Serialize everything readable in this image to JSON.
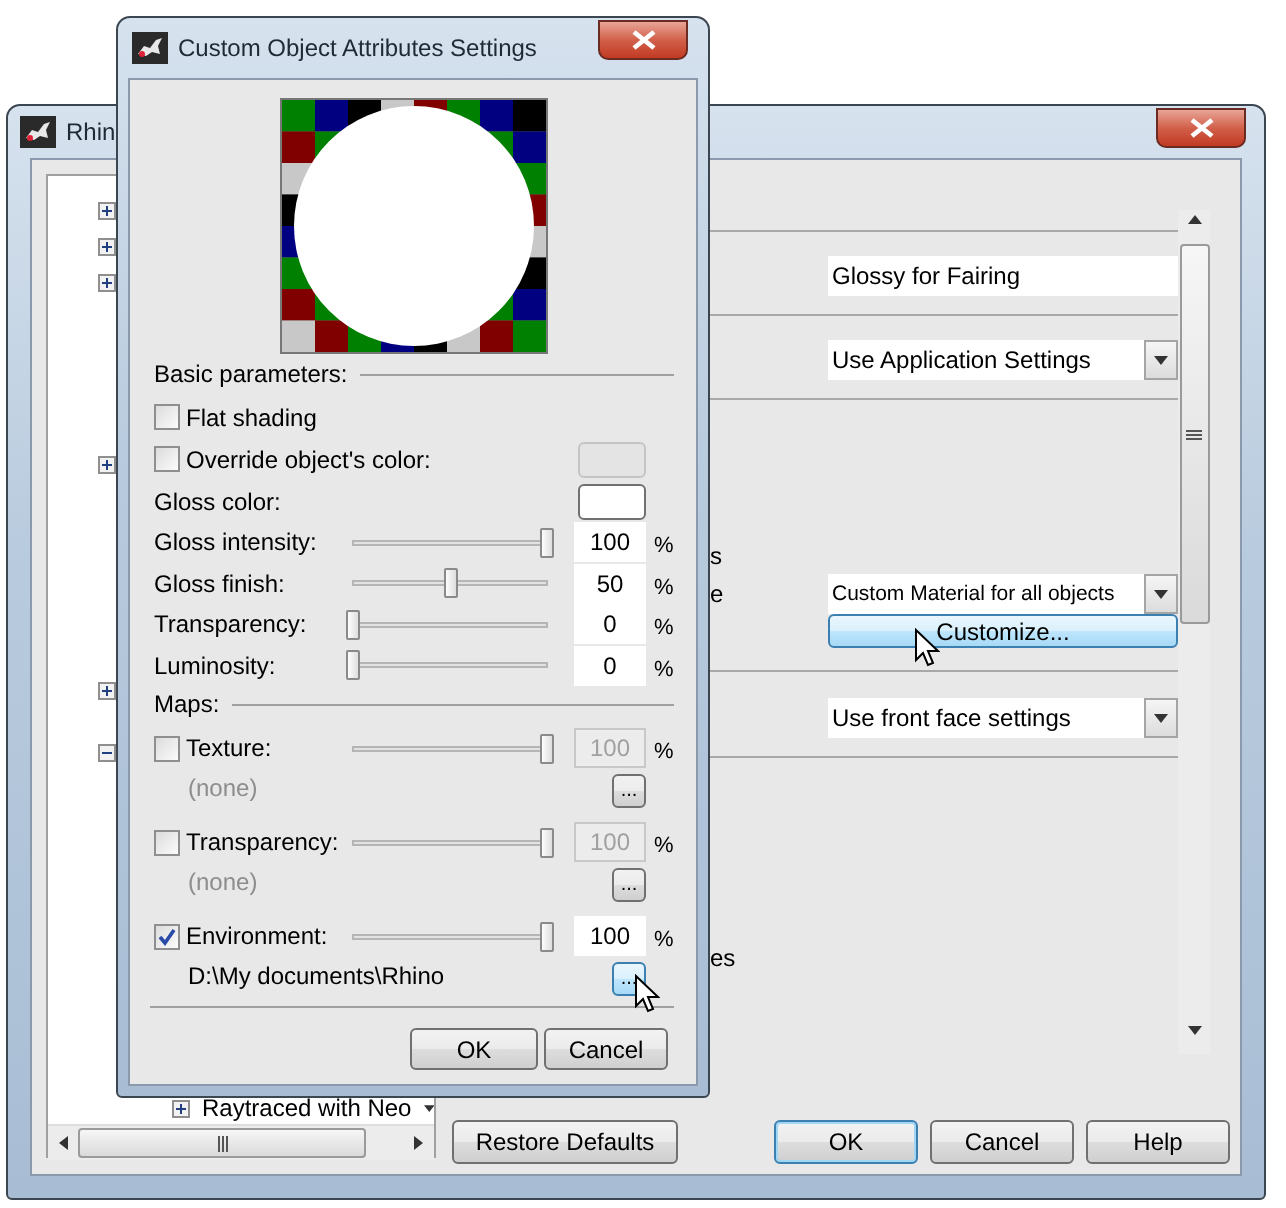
{
  "main_window": {
    "title": "Rhin",
    "tree": [
      {
        "expanded": false
      },
      {
        "expanded": false
      },
      {
        "expanded": false
      },
      {
        "expanded": false
      },
      {
        "expanded": false
      },
      {
        "expanded": true,
        "children": [
          {
            "label": "Raytraced with Neo",
            "expanded": false
          }
        ]
      }
    ],
    "sections": [
      {
        "field": {
          "kind": "text",
          "value": "Glossy for Fairing"
        }
      },
      {
        "field": {
          "kind": "dropdown",
          "value": "Use Application Settings"
        }
      },
      {
        "labels": [
          "s",
          "e"
        ],
        "field": {
          "kind": "dropdown",
          "value": "Custom Material for all objects"
        },
        "button": {
          "label": "Customize...",
          "hovered": true
        }
      },
      {
        "field": {
          "kind": "dropdown",
          "value": "Use front face settings"
        }
      },
      {
        "labels": [
          "es"
        ]
      }
    ],
    "restore_button": "Restore Defaults",
    "buttons": [
      {
        "label": "OK",
        "default": true
      },
      {
        "label": "Cancel",
        "default": false
      },
      {
        "label": "Help",
        "default": false
      }
    ]
  },
  "dialog": {
    "title": "Custom Object Attributes Settings",
    "basic": {
      "heading": "Basic parameters:",
      "flat_shading": {
        "label": "Flat shading",
        "checked": false
      },
      "override_color": {
        "label": "Override object's color:",
        "checked": false
      },
      "gloss_color": {
        "label": "Gloss color:"
      },
      "sliders": [
        {
          "label": "Gloss intensity:",
          "level": 1,
          "value": "100",
          "unit": "%"
        },
        {
          "label": "Gloss finish:",
          "level": 0.5,
          "value": "50",
          "unit": "%"
        },
        {
          "label": "Transparency:",
          "level": 0,
          "value": "0",
          "unit": "%"
        },
        {
          "label": "Luminosity:",
          "level": 0,
          "value": "0",
          "unit": "%"
        }
      ]
    },
    "maps": {
      "heading": "Maps:",
      "items": [
        {
          "label": "Texture:",
          "checked": false,
          "level": 1,
          "value": "100",
          "unit": "%",
          "file": "(none)",
          "browse": {
            "label": "...",
            "hovered": false
          }
        },
        {
          "label": "Transparency:",
          "checked": false,
          "level": 1,
          "value": "100",
          "unit": "%",
          "file": "(none)",
          "browse": {
            "label": "...",
            "hovered": false
          }
        },
        {
          "label": "Environment:",
          "checked": true,
          "level": 1,
          "value": "100",
          "unit": "%",
          "file": "D:\\My documents\\Rhino",
          "browse": {
            "label": "...",
            "hovered": true
          }
        }
      ]
    },
    "buttons": [
      {
        "label": "OK",
        "default": false
      },
      {
        "label": "Cancel",
        "default": false
      }
    ]
  }
}
